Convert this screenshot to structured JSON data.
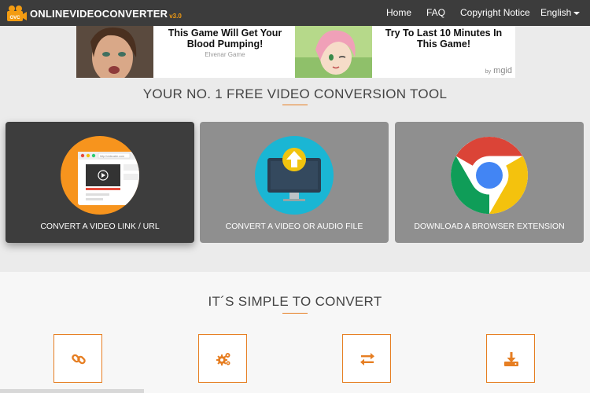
{
  "nav": {
    "logo_main": "Online",
    "logo_rest": "Video",
    "logo_tail": "Converter",
    "logo_version": "v3.0",
    "logo_badge": "OVC",
    "home": "Home",
    "faq": "FAQ",
    "copyright": "Copyright Notice",
    "language": "English"
  },
  "ad": {
    "card1_title": "This Game Will Get Your Blood Pumping!",
    "card1_source": "Elvenar Game",
    "card2_title": "Try To Last 10 Minutes In This Game!",
    "by_prefix": "by",
    "by_brand": "mgid"
  },
  "hero": {
    "title": "YOUR NO. 1 FREE VIDEO CONVERSION TOOL"
  },
  "cards": [
    {
      "label": "CONVERT A VIDEO LINK / URL",
      "url_text": "http://videosite.com"
    },
    {
      "label": "CONVERT A VIDEO OR AUDIO FILE"
    },
    {
      "label": "DOWNLOAD A BROWSER EXTENSION"
    }
  ],
  "steps_section": {
    "title": "IT´S SIMPLE TO CONVERT",
    "icons": [
      "link-icon",
      "gears-icon",
      "exchange-icon",
      "download-icon"
    ]
  },
  "colors": {
    "accent": "#e67e22",
    "nav_bg": "#3c3c3c",
    "card_active": "#3d3d3d",
    "card_inactive": "#8f8f8f"
  }
}
